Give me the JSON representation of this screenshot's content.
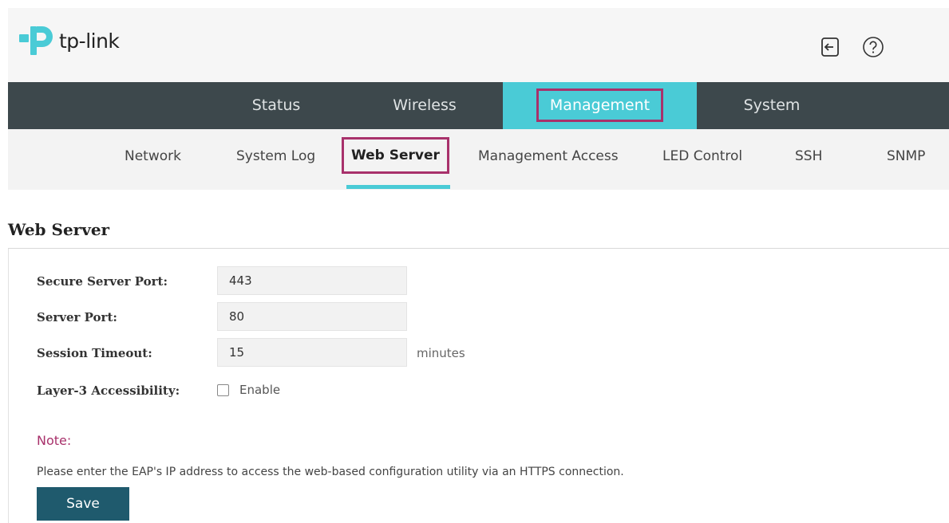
{
  "header": {
    "brand": "tp-link",
    "icons": [
      "logout-icon",
      "help-icon"
    ]
  },
  "main_nav": {
    "tabs": [
      {
        "label": "Status"
      },
      {
        "label": "Wireless"
      },
      {
        "label": "Management",
        "active": true
      },
      {
        "label": "System"
      }
    ]
  },
  "sub_nav": {
    "items": [
      {
        "label": "Network"
      },
      {
        "label": "System Log"
      },
      {
        "label": "Web Server",
        "active": true
      },
      {
        "label": "Management Access"
      },
      {
        "label": "LED Control"
      },
      {
        "label": "SSH"
      },
      {
        "label": "SNMP"
      }
    ]
  },
  "section": {
    "title": "Web Server",
    "fields": {
      "secure_port": {
        "label": "Secure Server Port:",
        "value": "443"
      },
      "server_port": {
        "label": "Server Port:",
        "value": "80"
      },
      "session_timeout": {
        "label": "Session Timeout:",
        "value": "15",
        "unit": "minutes"
      },
      "layer3": {
        "label": "Layer-3 Accessibility:",
        "checkbox_label": "Enable",
        "checked": false
      }
    },
    "note_title": "Note:",
    "note_text": "Please enter the EAP's IP address to access the web-based configuration utility via an HTTPS connection.",
    "save_label": "Save"
  },
  "colors": {
    "accent": "#4acbd6",
    "highlight": "#a8316b",
    "nav_bg": "#3d484c",
    "button": "#1f5a6d"
  }
}
